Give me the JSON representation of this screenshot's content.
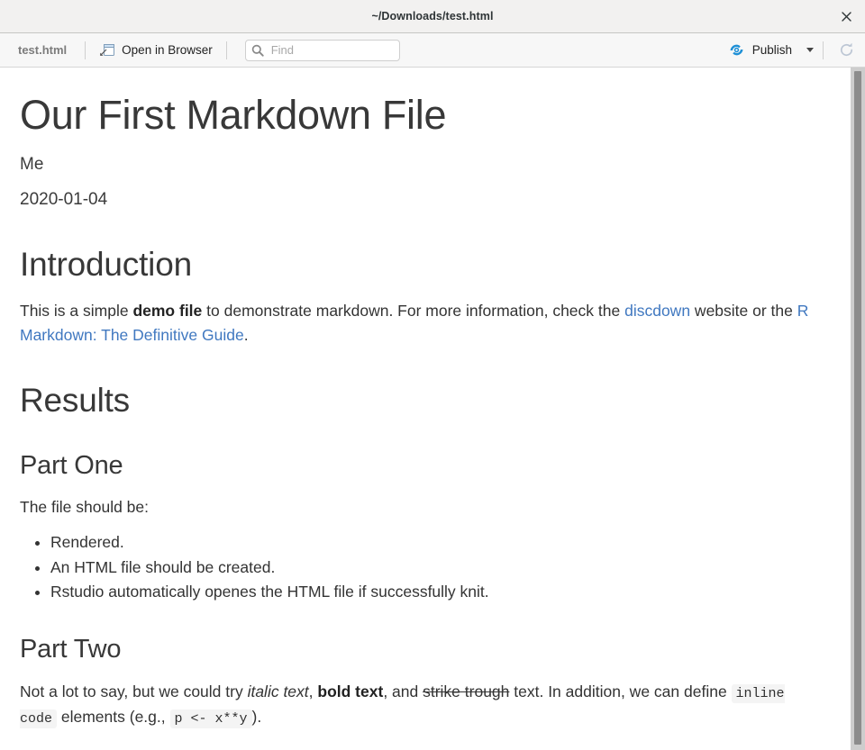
{
  "window": {
    "title": "~/Downloads/test.html",
    "close_label": "×"
  },
  "toolbar": {
    "filename": "test.html",
    "open_in_browser_label": "Open in Browser",
    "open_in_browser_icon": "external-window-icon",
    "find_placeholder": "Find",
    "find_value": "",
    "search_icon": "search-icon",
    "publish_label": "Publish",
    "publish_icon": "publish-icon",
    "publish_caret_icon": "chevron-down-icon",
    "refresh_icon": "refresh-icon"
  },
  "document": {
    "title": "Our First Markdown File",
    "author": "Me",
    "date": "2020-01-04",
    "sections": {
      "introduction": {
        "heading": "Introduction",
        "paragraph": {
          "p1": "This is a simple ",
          "bold1": "demo file",
          "p2": " to demonstrate markdown. For more information, check the ",
          "link1": "discdown",
          "p3": " website or the ",
          "link2": "R Markdown: The Definitive Guide",
          "p4": "."
        }
      },
      "results": {
        "heading": "Results",
        "part_one": {
          "heading": "Part One",
          "intro": "The file should be:",
          "items": [
            "Rendered.",
            "An HTML file should be created.",
            "Rstudio automatically openes the HTML file if successfully knit."
          ]
        },
        "part_two": {
          "heading": "Part Two",
          "paragraph": {
            "p1": "Not a lot to say, but we could try ",
            "italic1": "italic text",
            "p2": ", ",
            "bold1": "bold text",
            "p3": ", and ",
            "strike1": "strike trough",
            "p4": " text. In addition, we can define ",
            "code1": "inline code",
            "p5": " elements (e.g., ",
            "code2": "p <- x**y",
            "p6": ")."
          }
        }
      }
    }
  },
  "colors": {
    "link": "#4078c0",
    "publish_blue": "#1f90d6",
    "titlebar_bg": "#f2f1f0",
    "toolbar_bg": "#f7f7f7",
    "scrollbar_track": "#cdcdcd",
    "scrollbar_thumb": "#8c8c8c",
    "code_bg": "#f4f4f4"
  }
}
